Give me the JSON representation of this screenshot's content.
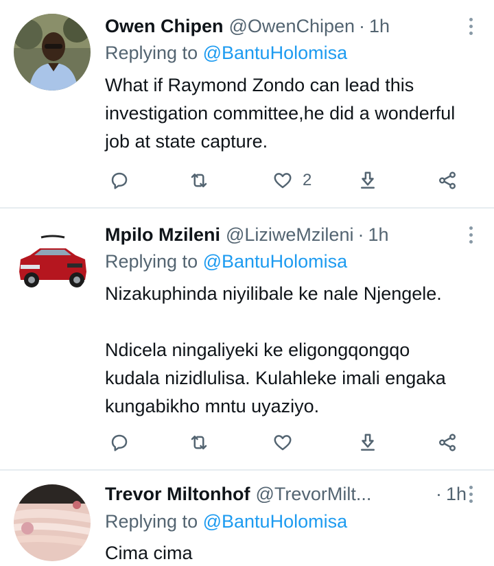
{
  "tweets": [
    {
      "name": "Owen Chipen",
      "handle": "@OwenChipen",
      "time": "1h",
      "replying_prefix": "Replying to",
      "replying_to": "@BantuHolomisa",
      "text_lines": [
        "What if Raymond Zondo can lead this investigation committee,he did a wonderful job at state capture."
      ],
      "likes": "2",
      "avatar": "person-photo"
    },
    {
      "name": "Mpilo Mzileni",
      "handle": "@LiziweMzileni",
      "time": "1h",
      "replying_prefix": "Replying to",
      "replying_to": "@BantuHolomisa",
      "paragraphs": [
        "Nizakuphinda niyilibale ke nale Njengele.",
        "Ndicela ningaliyeki ke eligongqongqo kudala nizidlulisa. Kulahleke imali engaka kungabikho mntu uyaziyo."
      ],
      "likes": "",
      "avatar": "red-car-photo"
    },
    {
      "name": "Trevor Miltonhof",
      "handle": "@TrevorMilt...",
      "time": "1h",
      "replying_prefix": "Replying to",
      "replying_to": "@BantuHolomisa",
      "text": "Cima cima",
      "avatar": "hands-photo"
    }
  ],
  "separator": "·",
  "icons": [
    "reply-icon",
    "retweet-icon",
    "like-icon",
    "bookmark-icon",
    "share-icon",
    "more-icon"
  ],
  "colors": {
    "link": "#1d9bf0",
    "muted": "#536471",
    "divider": "#e6ecf0"
  }
}
